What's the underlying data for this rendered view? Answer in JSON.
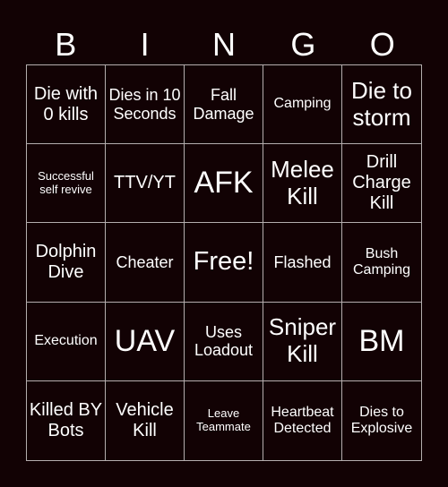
{
  "colors": {
    "background": "#120204",
    "grid_line": "#b4aeae",
    "text": "#ffffff"
  },
  "header": {
    "letters": [
      "B",
      "I",
      "N",
      "G",
      "O"
    ]
  },
  "board": {
    "rows": [
      [
        "Die with 0 kills",
        "Dies in 10 Seconds",
        "Fall Damage",
        "Camping",
        "Die to storm"
      ],
      [
        "Successful self revive",
        "TTV/YT",
        "AFK",
        "Melee Kill",
        "Drill Charge Kill"
      ],
      [
        "Dolphin Dive",
        "Cheater",
        "Free!",
        "Flashed",
        "Bush Camping"
      ],
      [
        "Execution",
        "UAV",
        "Uses Loadout",
        "Sniper Kill",
        "BM"
      ],
      [
        "Killed BY Bots",
        "Vehicle Kill",
        "Leave Teammate",
        "Heartbeat Detected",
        "Dies to Explosive"
      ]
    ]
  }
}
